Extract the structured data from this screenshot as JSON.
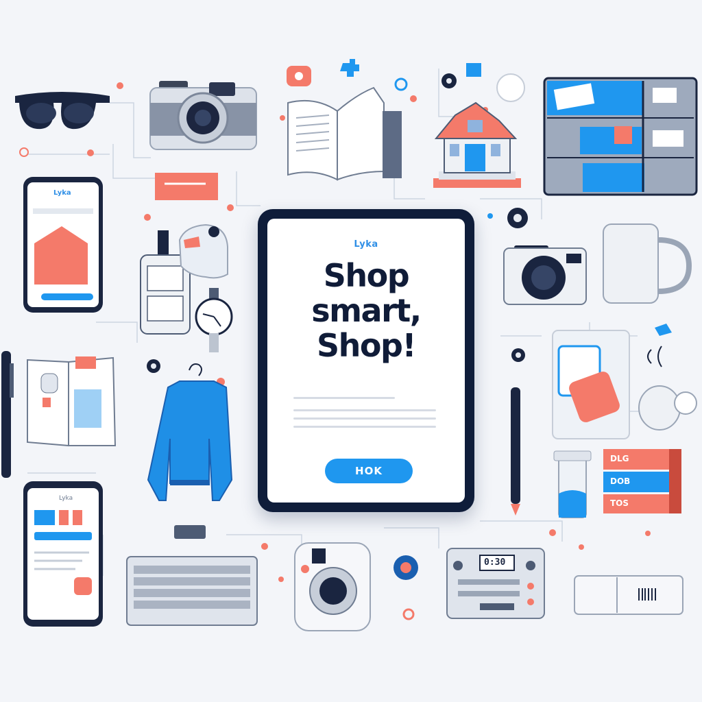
{
  "promo": {
    "brand": "Lyka",
    "headline_line1": "Shop",
    "headline_line2": "smart,",
    "headline_line3": "Shop!",
    "button_label": "HOK"
  },
  "phone_left_top": {
    "brand": "Lyka"
  },
  "phone_left_bottom": {
    "brand": "Lyka"
  },
  "books": {
    "labels": [
      "DLG",
      "DOB",
      "TOS"
    ]
  },
  "radio": {
    "display": "0:30"
  },
  "colors": {
    "background": "#f3f5f9",
    "navy": "#101c38",
    "accent_blue": "#1f97ef",
    "accent_coral": "#f47a6a",
    "gray": "#bcc4d0"
  },
  "icons": [
    "sunglasses-icon",
    "camera-icon",
    "open-book-icon",
    "house-icon",
    "filing-cabinet-icon",
    "smartphone-icon",
    "spray-bottle-icon",
    "kettle-icon",
    "watch-icon",
    "sweater-icon",
    "magazine-icon",
    "pen-icon",
    "compact-camera-icon",
    "mug-icon",
    "card-icon",
    "teapot-icon",
    "tube-icon",
    "book-stack-icon",
    "smartphone-icon",
    "keyboard-icon",
    "instant-camera-icon",
    "radio-icon",
    "usb-drive-icon"
  ]
}
